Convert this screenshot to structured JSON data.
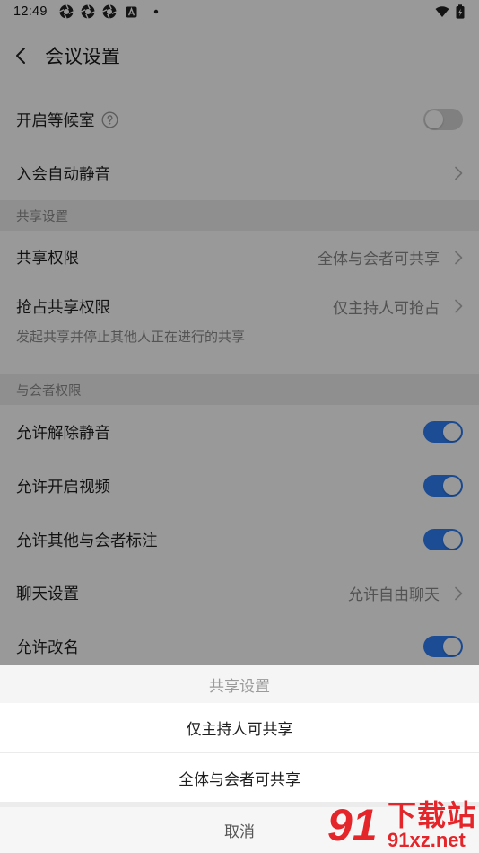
{
  "status_bar": {
    "time": "12:49",
    "icons": [
      "aperture-icon",
      "aperture-icon",
      "aperture-icon",
      "a-square-icon",
      "notification-dot-icon",
      "wifi-icon",
      "battery-charging-icon"
    ]
  },
  "header": {
    "back_icon": "chevron-left-icon",
    "title": "会议设置"
  },
  "settings": {
    "waiting_room": {
      "label": "开启等候室",
      "help_icon": "question-circle-icon",
      "enabled": false
    },
    "auto_mute": {
      "label": "入会自动静音"
    },
    "share_section": {
      "title": "共享设置",
      "share_permission": {
        "label": "共享权限",
        "value": "全体与会者可共享"
      },
      "preempt_share": {
        "label": "抢占共享权限",
        "value": "仅主持人可抢占",
        "description": "发起共享并停止其他人正在进行的共享"
      }
    },
    "participant_section": {
      "title": "与会者权限",
      "items": [
        {
          "label": "允许解除静音",
          "enabled": true
        },
        {
          "label": "允许开启视频",
          "enabled": true
        },
        {
          "label": "允许其他与会者标注",
          "enabled": true
        },
        {
          "label": "聊天设置",
          "value": "允许自由聊天"
        },
        {
          "label": "允许改名",
          "enabled": true
        }
      ]
    }
  },
  "action_sheet": {
    "title": "共享设置",
    "options": [
      {
        "label": "仅主持人可共享"
      },
      {
        "label": "全体与会者可共享"
      }
    ],
    "cancel": "取消"
  },
  "watermark": {
    "logo": "91",
    "name": "下载站",
    "url": "91xz.net"
  },
  "colors": {
    "accent": "#2f7ff5",
    "watermark": "#e4262b"
  }
}
